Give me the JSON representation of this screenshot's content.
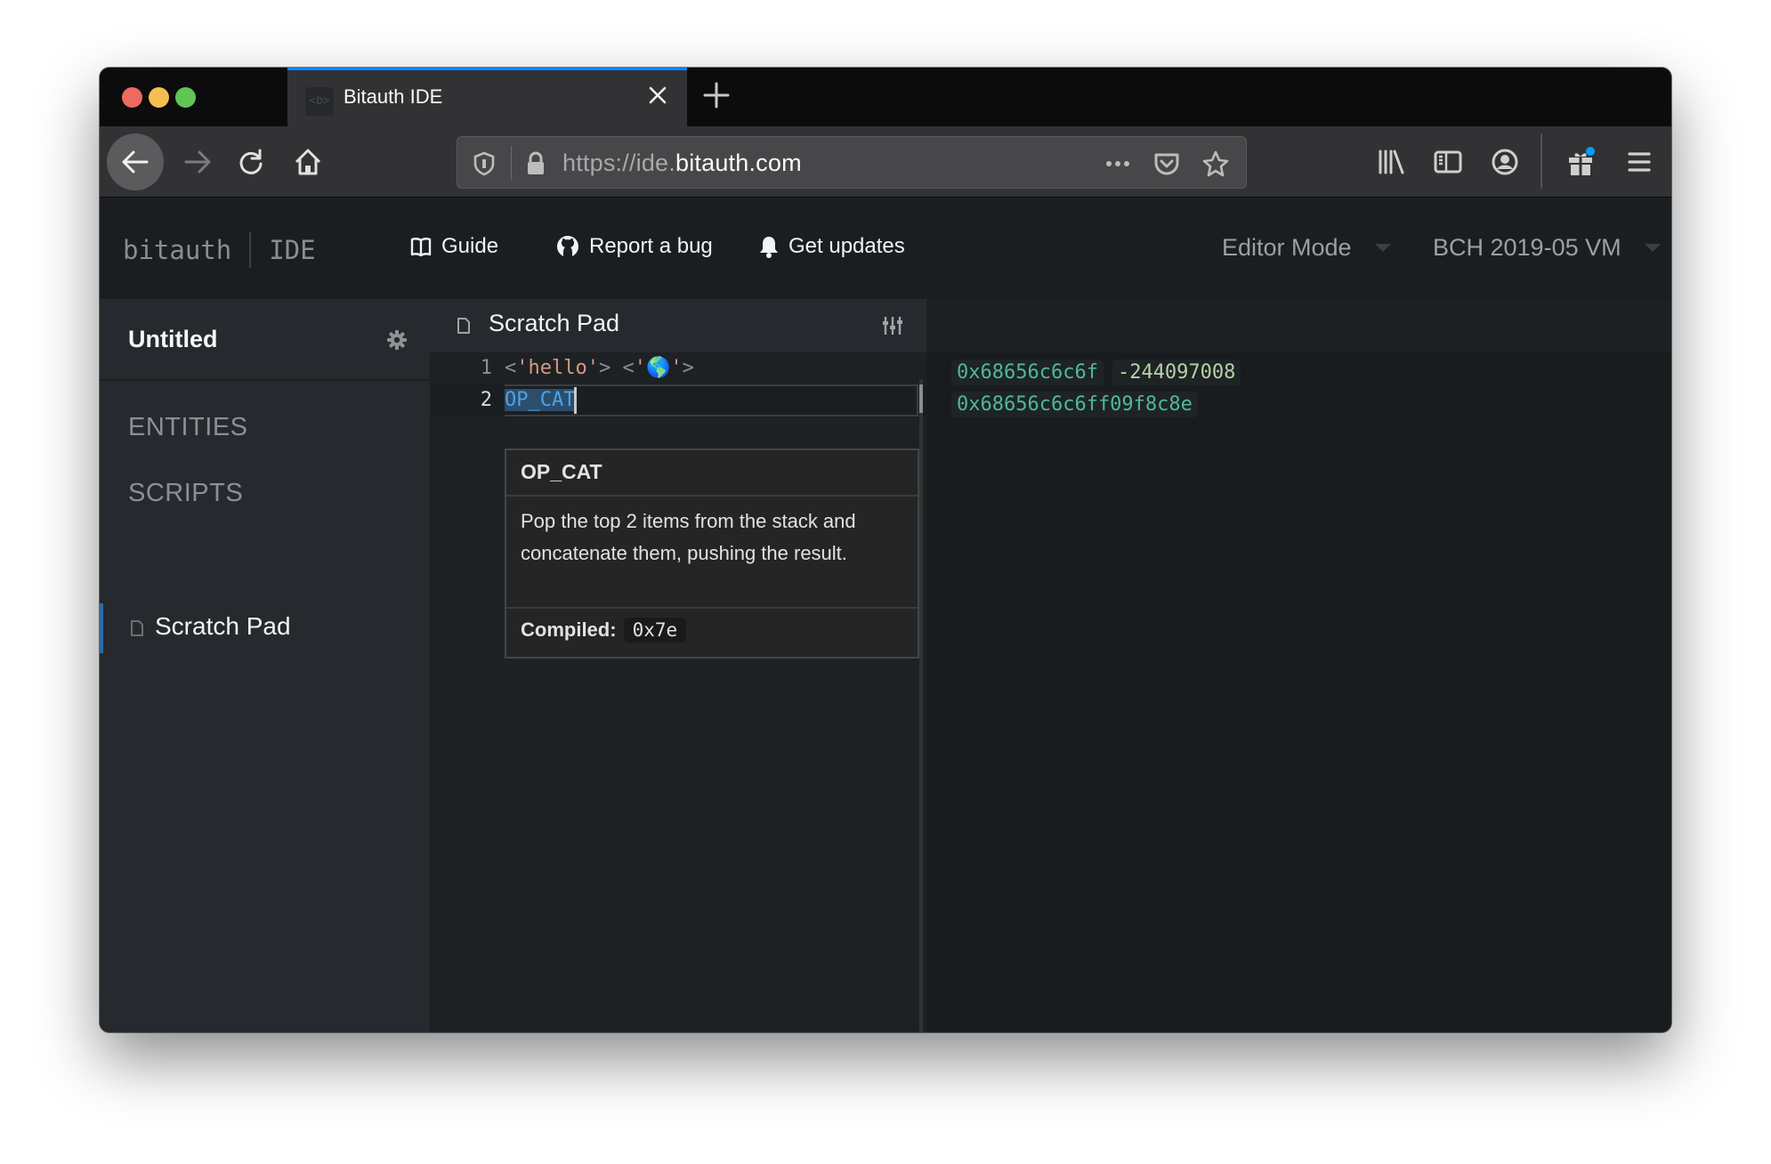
{
  "browser": {
    "tab": {
      "title": "Bitauth IDE",
      "favicon_text": "<b>"
    },
    "url": {
      "prefix": "https://ide.",
      "host": "bitauth.com"
    },
    "toolbar_icons": [
      "back-icon",
      "forward-icon",
      "reload-icon",
      "home-icon",
      "tracking-shield-icon",
      "lock-icon",
      "more-icon",
      "pocket-icon",
      "bookmark-star-icon",
      "library-icon",
      "sidebar-icon",
      "account-icon",
      "gift-icon",
      "hamburger-menu-icon"
    ],
    "accent": "#0a84ff"
  },
  "app": {
    "brand": {
      "name": "bitauth",
      "product": "IDE"
    },
    "nav": [
      {
        "label": "Guide",
        "icon": "book-icon"
      },
      {
        "label": "Report a bug",
        "icon": "github-icon"
      },
      {
        "label": "Get updates",
        "icon": "bell-icon"
      }
    ],
    "editor_mode": {
      "selected": "Editor Mode"
    },
    "vm": {
      "selected": "BCH 2019-05 VM"
    }
  },
  "sidebar": {
    "project_title": "Untitled",
    "sections": [
      {
        "label": "ENTITIES"
      },
      {
        "label": "SCRIPTS"
      }
    ],
    "scripts": [
      {
        "label": "Scratch Pad",
        "active": true
      }
    ]
  },
  "editor": {
    "title": "Scratch Pad",
    "lines": [
      {
        "number": "1",
        "tokens": [
          "<",
          "'hello'",
          ">",
          " ",
          "<",
          "'🌎'",
          ">"
        ]
      },
      {
        "number": "2",
        "text": "OP_CAT"
      }
    ],
    "hover": {
      "title": "OP_CAT",
      "description": "Pop the top 2 items from the stack and concatenate them, pushing the result.",
      "compiled_label": "Compiled:",
      "compiled_value": "0x7e"
    }
  },
  "results": {
    "lines": [
      {
        "items": [
          {
            "text": "0x68656c6c6f",
            "kind": "hex"
          },
          {
            "text": "-244097008",
            "kind": "num"
          }
        ]
      },
      {
        "items": [
          {
            "text": "0x68656c6c6ff09f8c8e",
            "kind": "hex"
          }
        ]
      }
    ]
  }
}
